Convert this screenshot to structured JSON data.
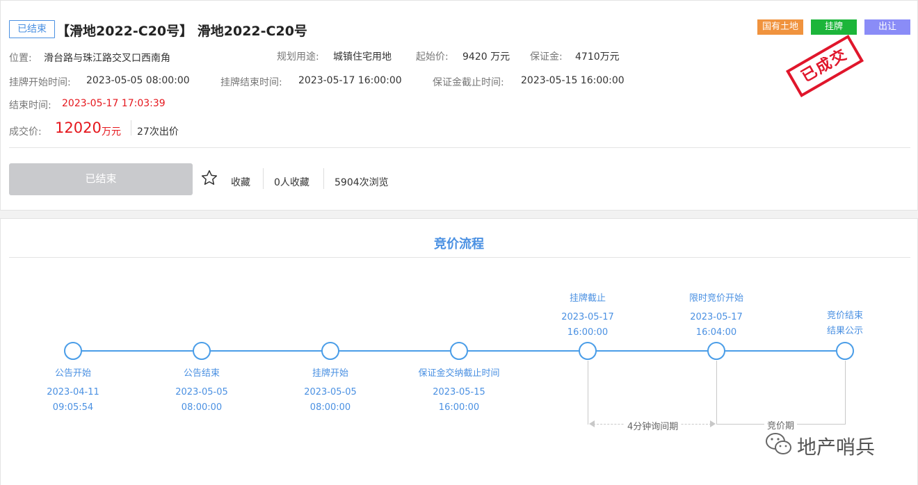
{
  "info": {
    "status_tag": "已结束",
    "title": "【滑地2022-C20号】 滑地2022-C20号",
    "badges": [
      {
        "label": "国有土地",
        "color": "#f0933e"
      },
      {
        "label": "挂牌",
        "color": "#1cb53a"
      },
      {
        "label": "出让",
        "color": "#8a8cf7"
      }
    ],
    "stamp": "已成交",
    "location_label": "位置:",
    "location": "滑台路与珠江路交叉口西南角",
    "usage_label": "规划用途:",
    "usage": "城镇住宅用地",
    "start_price_label": "起始价:",
    "start_price": "9420 万元",
    "deposit_label": "保证金:",
    "deposit": "4710万元",
    "listing_start_label": "挂牌开始时间:",
    "listing_start": "2023-05-05 08:00:00",
    "listing_end_label": "挂牌结束时间:",
    "listing_end": "2023-05-17 16:00:00",
    "deposit_deadline_label": "保证金截止时间:",
    "deposit_deadline": "2023-05-15 16:00:00",
    "end_time_label": "结束时间:",
    "end_time": "2023-05-17 17:03:39",
    "deal_price_label": "成交价:",
    "deal_price": "12020",
    "deal_price_unit": "万元",
    "bid_count": "27次出价",
    "end_button": "已结束",
    "favorite_label": "收藏",
    "favorite_count": "0人收藏",
    "view_count": "5904次浏览"
  },
  "flow": {
    "title": "竞价流程",
    "nodes": [
      {
        "label": "公告开始",
        "date": "2023-04-11",
        "time": "09:05:54"
      },
      {
        "label": "公告结束",
        "date": "2023-05-05",
        "time": "08:00:00"
      },
      {
        "label": "挂牌开始",
        "date": "2023-05-05",
        "time": "08:00:00"
      },
      {
        "label": "保证金交纳截止时间",
        "date": "2023-05-15",
        "time": "16:00:00"
      },
      {
        "label": "挂牌截止",
        "date": "2023-05-17",
        "time": "16:00:00"
      },
      {
        "label": "限时竞价开始",
        "date": "2023-05-17",
        "time": "16:04:00"
      },
      {
        "label": "竞价结束",
        "date": "结果公示",
        "time": ""
      }
    ],
    "inquiry_period": "4分钟询间期",
    "bidding_period": "竞价期"
  },
  "watermark": "地产哨兵"
}
